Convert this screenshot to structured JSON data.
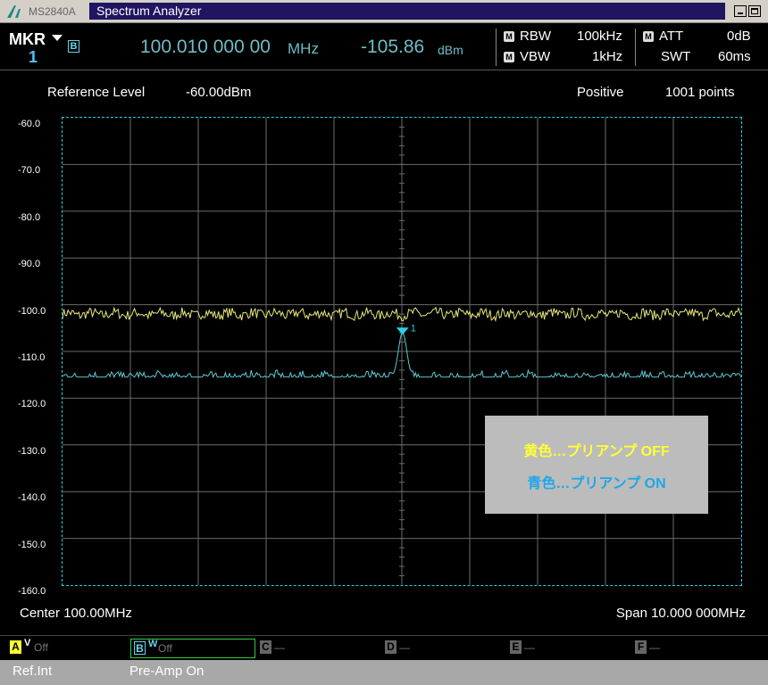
{
  "titlebar": {
    "model": "MS2840A",
    "app_title": "Spectrum Analyzer"
  },
  "marker": {
    "label": "MKR",
    "number": "1",
    "trace": "B",
    "frequency": "100.010 000 00",
    "frequency_unit": "MHz",
    "level": "-105.86",
    "level_unit": "dBm"
  },
  "params": {
    "rbw_label": "RBW",
    "rbw_value": "100kHz",
    "vbw_label": "VBW",
    "vbw_value": "1kHz",
    "att_label": "ATT",
    "att_value": "0dB",
    "swt_label": "SWT",
    "swt_value": "60ms",
    "manual_badge": "M"
  },
  "info": {
    "ref_label": "Reference Level",
    "ref_value": "-60.00dBm",
    "detector": "Positive",
    "points": "1001 points"
  },
  "axis": {
    "y_ticks": [
      "-60.0",
      "-70.0",
      "-80.0",
      "-90.0",
      "-100.0",
      "-110.0",
      "-120.0",
      "-130.0",
      "-140.0",
      "-150.0",
      "-160.0"
    ],
    "center": "Center 100.00MHz",
    "span": "Span 10.000 000MHz"
  },
  "callout": {
    "yellow_text": "黄色…プリアンプ OFF",
    "blue_text": "青色…プリアンプ ON"
  },
  "traces": [
    {
      "letter": "A",
      "mode": "V",
      "state": "Off"
    },
    {
      "letter": "B",
      "mode": "W",
      "state": "Off"
    },
    {
      "letter": "C",
      "state": "—"
    },
    {
      "letter": "D",
      "state": "—"
    },
    {
      "letter": "E",
      "state": "—"
    },
    {
      "letter": "F",
      "state": "—"
    }
  ],
  "status": {
    "ref": "Ref.Int",
    "preamp": "Pre-Amp On"
  },
  "colors": {
    "trace_off": "#e8e87a",
    "trace_on": "#5fc7d3",
    "grid": "#6a6a6a",
    "border": "#2bd0e8"
  },
  "chart_data": {
    "type": "line",
    "x_range_mhz": [
      95,
      105
    ],
    "ylim": [
      -160,
      -60
    ],
    "marker": {
      "x": 100.01,
      "y": -105.86,
      "label": "1"
    },
    "series": [
      {
        "name": "黄色…プリアンプ OFF",
        "color": "#e8e87a",
        "noise_floor_db": -102.0
      },
      {
        "name": "青色…プリアンプ ON",
        "color": "#5fc7d3",
        "noise_floor_db": -115.5,
        "peak_x": 100.01,
        "peak_db": -105.86
      }
    ]
  }
}
